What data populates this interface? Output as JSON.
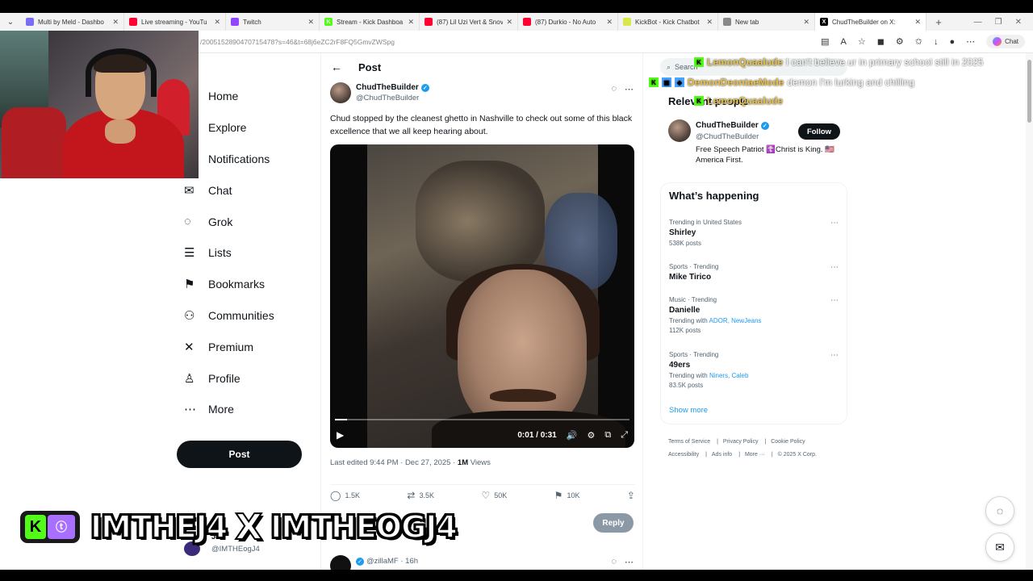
{
  "browser": {
    "tabs": [
      {
        "label": "Multi by Meld - Dashbo",
        "fav_color": "#7b6cf6",
        "fav_glyph": ""
      },
      {
        "label": "Live streaming - YouTu",
        "fav_color": "#ff0033",
        "fav_glyph": ""
      },
      {
        "label": "Twitch",
        "fav_color": "#9146ff",
        "fav_glyph": ""
      },
      {
        "label": "Stream - Kick Dashboa",
        "fav_color": "#53fc18",
        "fav_glyph": "K"
      },
      {
        "label": "(87) Lil Uzi Vert & Snov",
        "fav_color": "#ff0033",
        "fav_glyph": ""
      },
      {
        "label": "(87) Durkio - No Auto",
        "fav_color": "#ff0033",
        "fav_glyph": ""
      },
      {
        "label": "KickBot - Kick Chatbot",
        "fav_color": "#d8e84a",
        "fav_glyph": ""
      },
      {
        "label": "New tab",
        "fav_color": "#888888",
        "fav_glyph": ""
      },
      {
        "label": "ChudTheBuilder on X:",
        "fav_color": "#000000",
        "fav_glyph": "X"
      }
    ],
    "url": "/2005152890470715478?s=46&t=68j6eZC2rF8FQ5GmvZWSpg",
    "chat_label": "Chat"
  },
  "nav": {
    "items": [
      {
        "label": "Home",
        "icon": ""
      },
      {
        "label": "Explore",
        "icon": ""
      },
      {
        "label": "Notifications",
        "icon": ""
      },
      {
        "label": "Chat",
        "icon": "✉"
      },
      {
        "label": "Grok",
        "icon": "◌"
      },
      {
        "label": "Lists",
        "icon": "☰"
      },
      {
        "label": "Bookmarks",
        "icon": "⚑"
      },
      {
        "label": "Communities",
        "icon": "⚇"
      },
      {
        "label": "Premium",
        "icon": "✕"
      },
      {
        "label": "Profile",
        "icon": "♙"
      },
      {
        "label": "More",
        "icon": "⋯"
      }
    ],
    "post_button": "Post"
  },
  "post": {
    "header": "Post",
    "author_name": "ChudTheBuilder",
    "author_handle": "@ChudTheBuilder",
    "text": "Chud stopped by the cleanest ghetto in Nashville to check out some of this black excellence that we all keep hearing about.",
    "video_time": "0:01 / 0:31",
    "video_progress": 0.04,
    "edited_prefix": "Last edited 9:44 PM · Dec 27, 2025 · ",
    "views_count": "1M",
    "views_label": " Views",
    "replies": "1.5K",
    "reposts": "3.5K",
    "likes": "50K",
    "bookmarks": "10K",
    "reply_button": "Reply",
    "next_reply_handle": "@zillaMF · 16h"
  },
  "under_banner": {
    "name": "J4",
    "handle": "@IMTHEogJ4"
  },
  "right": {
    "search_placeholder": "Search",
    "relevant_title": "Relevant people",
    "rel_name": "ChudTheBuilder",
    "rel_handle": "@ChudTheBuilder",
    "rel_bio": "Free Speech Patriot ☦️Christ is King. 🇺🇸 America First.",
    "follow": "Follow",
    "happening_title": "What’s happening",
    "trends": [
      {
        "category": "Trending in United States",
        "name": "Shirley",
        "count": "538K posts",
        "with_prefix": "",
        "with": ""
      },
      {
        "category": "Sports · Trending",
        "name": "Mike Tirico",
        "count": "",
        "with_prefix": "",
        "with": ""
      },
      {
        "category": "Music · Trending",
        "name": "Danielle",
        "count": "112K posts",
        "with_prefix": "Trending with ",
        "with": "ADOR, NewJeans"
      },
      {
        "category": "Sports · Trending",
        "name": "49ers",
        "count": "83.5K posts",
        "with_prefix": "Trending with ",
        "with": "Niners, Caleb"
      }
    ],
    "show_more": "Show more",
    "footer": [
      "Terms of Service",
      "Privacy Policy",
      "Cookie Policy",
      "Accessibility",
      "Ads info",
      "More ···",
      "© 2025 X Corp."
    ]
  },
  "chat_overlay": [
    {
      "user": "LemonQuaalude",
      "msg": "I can't believe ur in primary school still in 2025"
    },
    {
      "user": "DemonDeontaeMode",
      "msg": "demon I'm lurking and chilling"
    },
    {
      "user": "LemonQuaalude",
      "msg": ""
    }
  ],
  "banner": {
    "left": "IMTHEJ4",
    "x": "X",
    "right": "IMTHEOGJ4",
    "icon_k": "K",
    "icon_t": "ⓣ"
  }
}
